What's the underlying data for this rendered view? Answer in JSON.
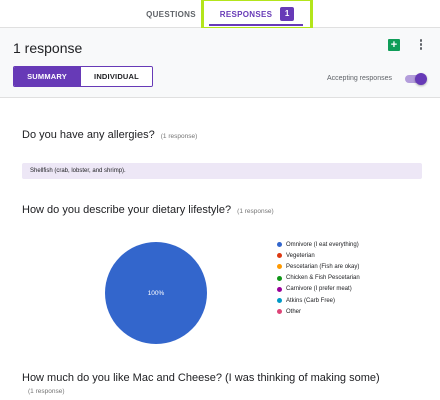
{
  "tabs": {
    "questions_label": "QUESTIONS",
    "responses_label": "RESPONSES",
    "responses_count": "1"
  },
  "header": {
    "title": "1 response",
    "summary_label": "SUMMARY",
    "individual_label": "INDIVIDUAL",
    "accepting_label": "Accepting responses",
    "accepting_on": true
  },
  "questions": [
    {
      "title": "Do you have any allergies?",
      "count": "(1 response)",
      "answer": "Shellfish (crab, lobster, and shrimp)."
    },
    {
      "title": "How do you describe your dietary lifestyle?",
      "count": "(1 response)",
      "pie_label": "100%",
      "legend": [
        {
          "label": "Omnivore (I eat everything)",
          "color": "#3366cc"
        },
        {
          "label": "Vegeterian",
          "color": "#dc3912"
        },
        {
          "label": "Pescetarian (Fish are okay)",
          "color": "#ff9900"
        },
        {
          "label": "Chicken & Fish Pescetarian",
          "color": "#109618"
        },
        {
          "label": "Carnivore (I prefer meat)",
          "color": "#990099"
        },
        {
          "label": "Atkins (Carb Free)",
          "color": "#0099c6"
        },
        {
          "label": "Other",
          "color": "#dd4477"
        }
      ]
    },
    {
      "title": "How much do you like Mac and Cheese? (I was thinking of making some)",
      "count": "(1 response)"
    }
  ],
  "chart_data": {
    "type": "pie",
    "categories": [
      "Omnivore (I eat everything)",
      "Vegeterian",
      "Pescetarian (Fish are okay)",
      "Chicken & Fish Pescetarian",
      "Carnivore (I prefer meat)",
      "Atkins (Carb Free)",
      "Other"
    ],
    "values": [
      100,
      0,
      0,
      0,
      0,
      0,
      0
    ],
    "colors": [
      "#3366cc",
      "#dc3912",
      "#ff9900",
      "#109618",
      "#990099",
      "#0099c6",
      "#dd4477"
    ],
    "legend_position": "right"
  },
  "colors": {
    "accent": "#673ab7",
    "highlight_outline": "#b3e51b",
    "sheets_green": "#0f9d58"
  },
  "icons": {
    "sheets": "sheets-icon",
    "more": "more-vert-icon"
  }
}
